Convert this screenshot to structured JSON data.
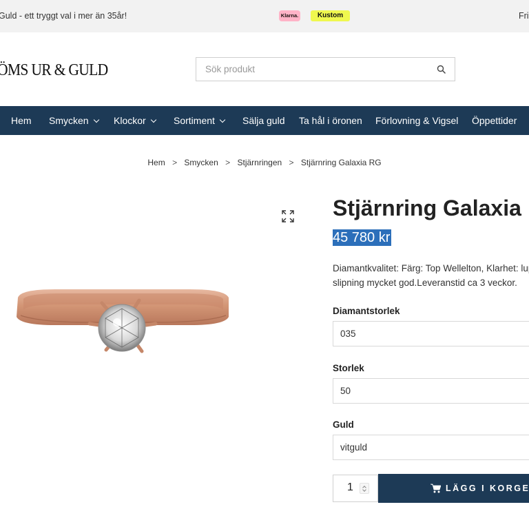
{
  "topbar": {
    "tagline": "Guld - ett tryggt val i mer än 35år!",
    "payment_klarna": "Klarna.",
    "payment_kustom": "Kustom",
    "right_link": "Fri"
  },
  "header": {
    "logo_text": "ÖMS UR & GULD",
    "search_placeholder": "Sök produkt"
  },
  "nav": {
    "items": [
      {
        "label": "Hem",
        "has_dropdown": false
      },
      {
        "label": "Smycken",
        "has_dropdown": true
      },
      {
        "label": "Klockor",
        "has_dropdown": true
      },
      {
        "label": "Sortiment",
        "has_dropdown": true
      },
      {
        "label": "Sälja guld",
        "has_dropdown": false
      },
      {
        "label": "Ta hål i öronen",
        "has_dropdown": false
      },
      {
        "label": "Förlovning & Vigsel",
        "has_dropdown": false
      },
      {
        "label": "Öppettider",
        "has_dropdown": false
      }
    ]
  },
  "breadcrumb": {
    "items": [
      "Hem",
      "Smycken",
      "Stjärnringen",
      "Stjärnring Galaxia RG"
    ],
    "separator": ">"
  },
  "product": {
    "title": "Stjärnring Galaxia",
    "price": "45 780 kr",
    "description_line1": "Diamantkvalitet: Färg: Top Wellelton, Klarhet: lup",
    "description_line2": "slipning mycket god.Leveranstid ca 3 veckor.",
    "options": [
      {
        "label": "Diamantstorlek",
        "value": "035"
      },
      {
        "label": "Storlek",
        "value": "50"
      },
      {
        "label": "Guld",
        "value": "vitguld"
      }
    ],
    "quantity": "1",
    "add_to_cart_label": "LÄGG I KORGEN"
  },
  "colors": {
    "nav_bg": "#1d3a56",
    "topbar_bg": "#f2f2f2",
    "price_highlight": "#2c6fba",
    "ring_gold": "#d49a7c"
  }
}
